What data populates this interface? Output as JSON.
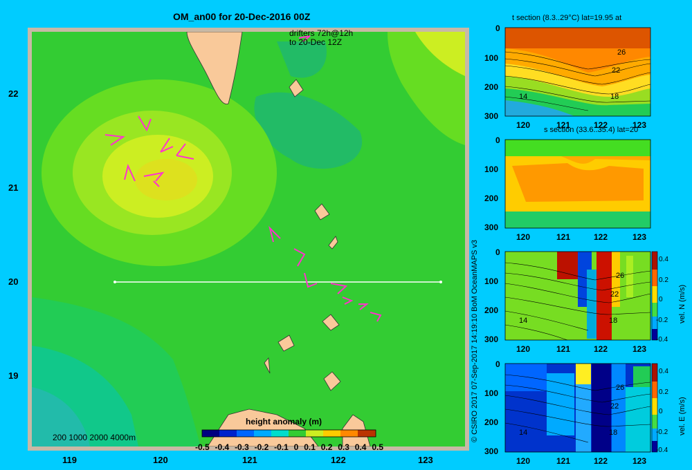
{
  "main_map": {
    "title": "OM_an00 for 20-Dec-2016 00Z",
    "drifter_note_line1": "drifters 72h@12h",
    "drifter_note_line2": "to 20-Dec 12Z",
    "x_ticks": [
      "119",
      "120",
      "121",
      "122",
      "123"
    ],
    "y_ticks": [
      "22",
      "21",
      "20",
      "19"
    ],
    "depth_legend": "200  1000  2000  4000m",
    "colorbar_title": "height anomaly  (m)",
    "colorbar_ticks": [
      "-0.5",
      "-0.4",
      "-0.3",
      "-0.2",
      "-0.1",
      "0",
      "0.1",
      "0.2",
      "0.3",
      "0.4",
      "0.5"
    ],
    "colors": {
      "background": "#00ccff",
      "land": "#f9c99a",
      "frame": "#c8b9a6",
      "drifter": "#ff33cc",
      "section_line": "#ffffff"
    }
  },
  "credit": "© CSIRO 2017   07-Sep-2017 14:19:10 BoM OceanMAPS v3",
  "sections": [
    {
      "title": "t section (8.3..29°C) lat=19.95 at",
      "x_ticks": [
        "120",
        "121",
        "122",
        "123"
      ],
      "y_ticks": [
        "0",
        "100",
        "200",
        "300"
      ],
      "contour_labels": [
        "26",
        "22",
        "18",
        "14"
      ]
    },
    {
      "title": "s section (33.6..35.4) lat=20",
      "x_ticks": [
        "120",
        "121",
        "122",
        "123"
      ],
      "y_ticks": [
        "0",
        "100",
        "200",
        "300"
      ]
    },
    {
      "title": "",
      "x_ticks": [
        "120",
        "121",
        "122",
        "123"
      ],
      "y_ticks": [
        "0",
        "100",
        "200",
        "300"
      ],
      "contour_labels": [
        "26",
        "22",
        "18",
        "14"
      ],
      "colorbar_label": "vel. N (m/s)",
      "colorbar_ticks": [
        "0.4",
        "0.2",
        "0",
        "-0.2",
        "-0.4"
      ]
    },
    {
      "title": "",
      "x_ticks": [
        "120",
        "121",
        "122",
        "123"
      ],
      "y_ticks": [
        "0",
        "100",
        "200",
        "300"
      ],
      "contour_labels": [
        "26",
        "22",
        "18",
        "14"
      ],
      "colorbar_label": "vel. E (m/s)",
      "colorbar_ticks": [
        "0.4",
        "0.2",
        "0",
        "-0.2",
        "-0.4"
      ]
    }
  ]
}
